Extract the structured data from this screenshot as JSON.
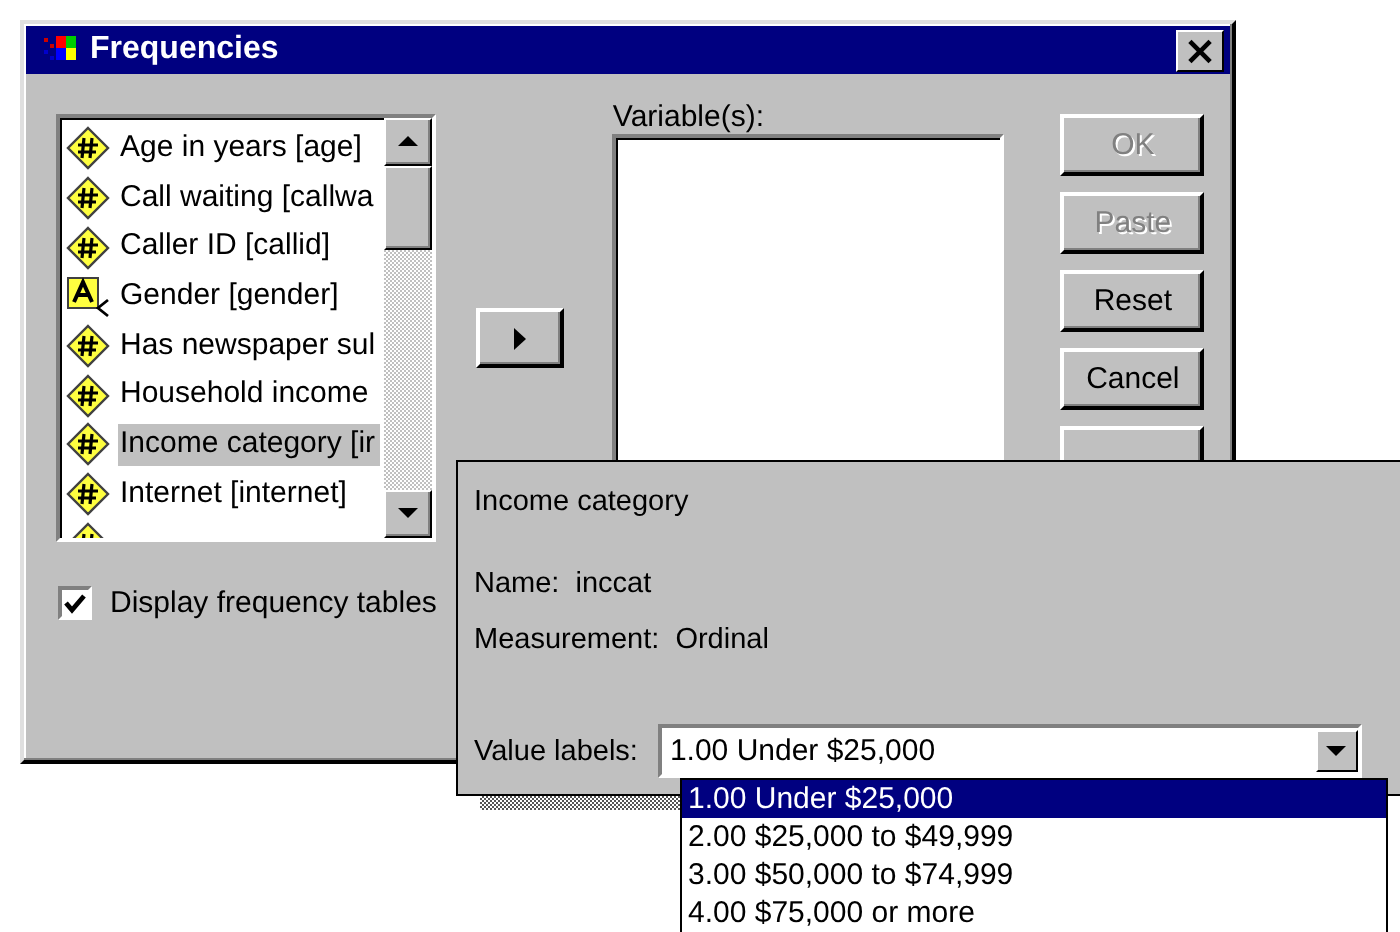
{
  "window": {
    "title": "Frequencies",
    "close": "×"
  },
  "variable_list": {
    "items": [
      {
        "label": "Age in years [age]",
        "kind": "scale",
        "selected": false
      },
      {
        "label": "Call waiting [callwa",
        "kind": "scale",
        "selected": false
      },
      {
        "label": "Caller ID [callid]",
        "kind": "scale",
        "selected": false
      },
      {
        "label": "Gender [gender]",
        "kind": "nominal",
        "selected": false
      },
      {
        "label": "Has newspaper sul",
        "kind": "scale",
        "selected": false
      },
      {
        "label": "Household income",
        "kind": "scale",
        "selected": false
      },
      {
        "label": "Income category [ir",
        "kind": "scale",
        "selected": true
      },
      {
        "label": "Internet [internet]",
        "kind": "scale",
        "selected": false
      }
    ]
  },
  "selected_variables": {
    "label": "Variable(s):"
  },
  "buttons": [
    {
      "label": "OK",
      "disabled": true
    },
    {
      "label": "Paste",
      "disabled": true
    },
    {
      "label": "Reset",
      "disabled": false
    },
    {
      "label": "Cancel",
      "disabled": false
    }
  ],
  "checkbox": {
    "label": "Display frequency tables",
    "checked": true
  },
  "info_popup": {
    "title": "Income category",
    "name_label": "Name:",
    "name": "inccat",
    "measurement_label": "Measurement:",
    "measurement": "Ordinal",
    "value_labels_label": "Value labels:",
    "value_labels_value": "1.00 Under $25,000",
    "options": [
      {
        "label": "1.00 Under $25,000",
        "selected": true
      },
      {
        "label": "2.00 $25,000 to $49,999",
        "selected": false
      },
      {
        "label": "3.00 $50,000 to $74,999",
        "selected": false
      },
      {
        "label": "4.00 $75,000 or more",
        "selected": false
      }
    ]
  }
}
